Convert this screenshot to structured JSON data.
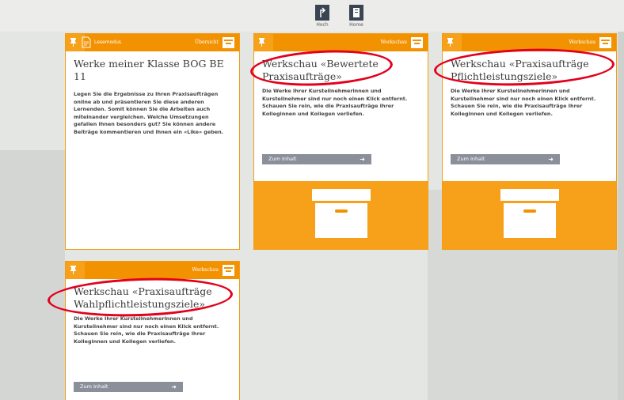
{
  "nav": {
    "up_label": "Hoch",
    "home_label": "Home"
  },
  "cards": [
    {
      "header_left_label": "Lesemodus",
      "header_right_label": "Übersicht",
      "title": "Werke meiner Klasse BOG BE 11",
      "body": "Legen Sie die Ergebnisse zu Ihren Praxisaufträgen online ab und präsentieren Sie diese anderen Lernenden. Somit können Sie die Arbeiten auch miteinander vergleichen. Welche Umsetzungen gefallen Ihnen besonders gut? Sie können andere Beiträge kommentieren und ihnen ein «Like» geben."
    },
    {
      "header_right_label": "Werkschau",
      "title": "Werkschau «Bewertete Praxisaufträge»",
      "body": "Die Werke Ihrer Kursteilnehmerinnen und Kursteilnehmer sind nur noch einen Klick entfernt. Schauen Sie rein, wie die Praxisaufträge Ihrer Kolleginnen und Kollegen verliefen.",
      "button_label": "Zum Inhalt"
    },
    {
      "header_right_label": "Werkschau",
      "title": "Werkschau «Praxisaufträge Pflichtleistungsziele»",
      "body": "Die Werke Ihrer Kursteilnehmerinnen und Kursteilnehmer sind nur noch einen Klick entfernt. Schauen Sie rein, wie die Praxisaufträge Ihrer Kolleginnen und Kollegen verliefen.",
      "button_label": "Zum Inhalt"
    },
    {
      "header_right_label": "Werkschau",
      "title": "Werkschau «Praxisaufträge Wahlpflichtleistungsziele»",
      "body": "Die Werke Ihrer Kursteilnehmerinnen und Kursteilnehmer sind nur noch einen Klick entfernt. Schauen Sie rein, wie die Praxisaufträge Ihrer Kolleginnen und Kollegen verliefen.",
      "button_label": "Zum Inhalt"
    }
  ],
  "colors": {
    "accent": "#f39200",
    "accent_light": "#f7a11a",
    "annotation": "#e3001b",
    "button": "#8a8f9a"
  }
}
